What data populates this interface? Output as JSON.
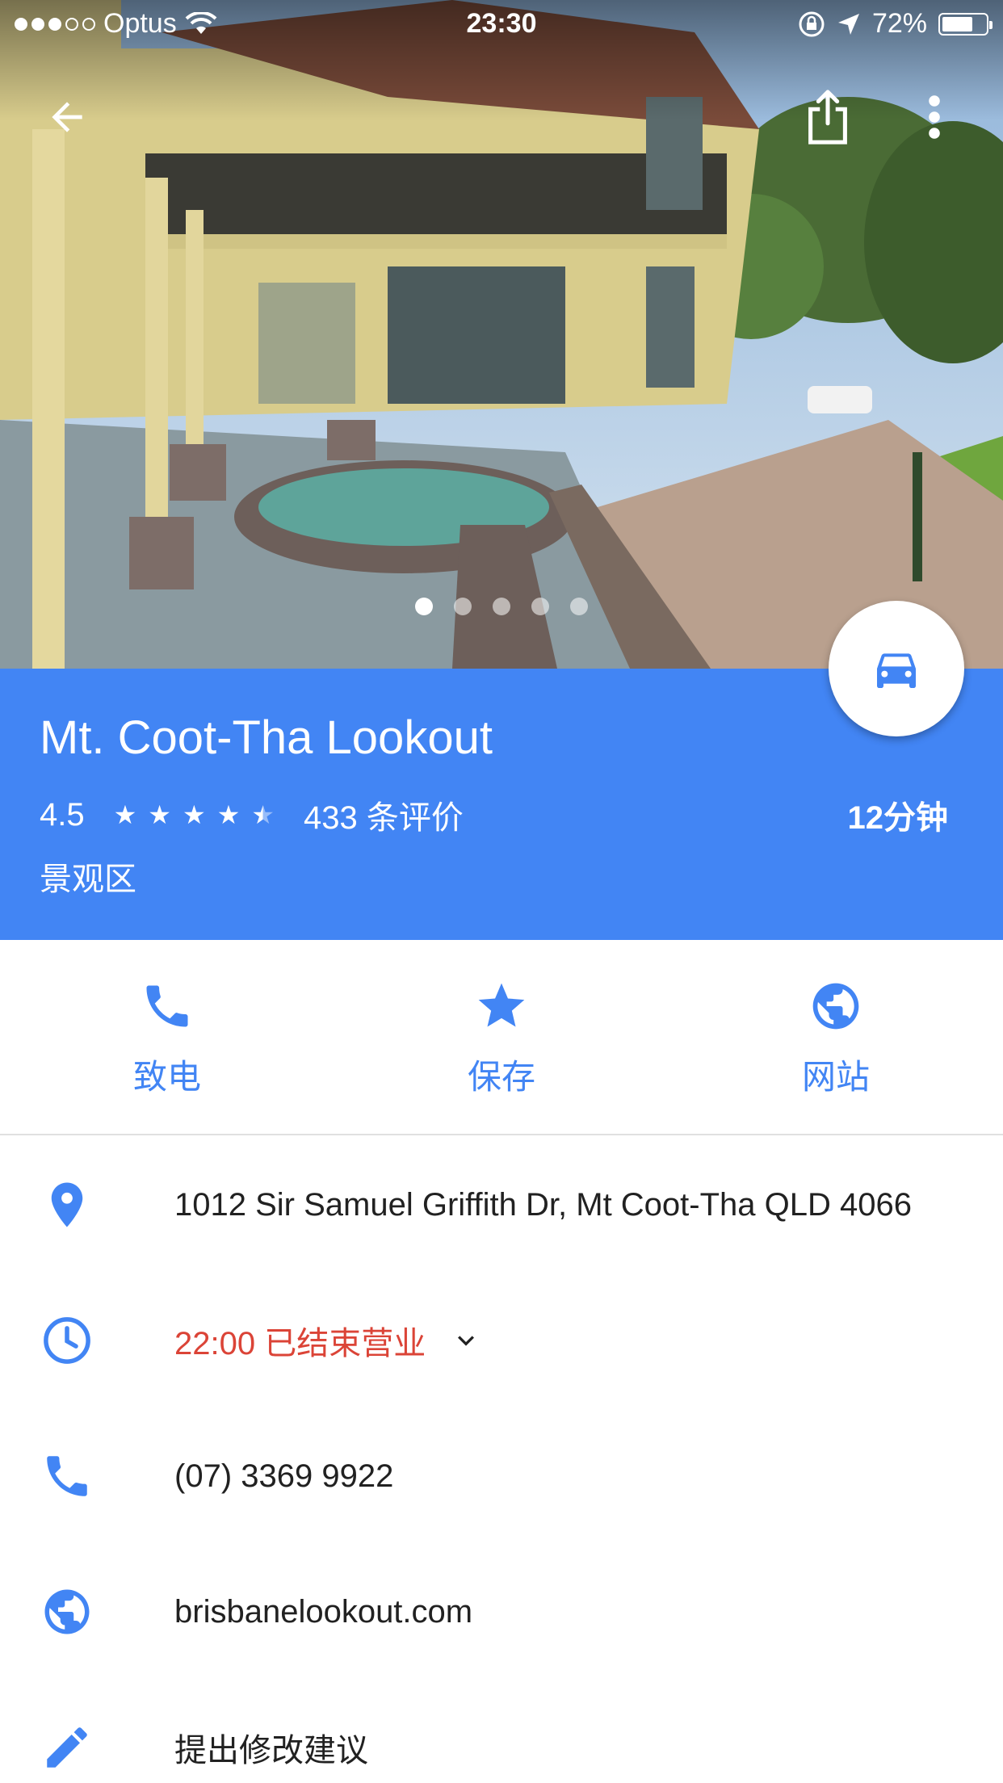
{
  "status_bar": {
    "carrier": "Optus",
    "time": "23:30",
    "battery": "72%",
    "battery_level": 0.72,
    "signal_bars_filled": 3,
    "signal_bars_total": 5
  },
  "hero": {
    "photo_count": 5,
    "active_photo": 1
  },
  "place": {
    "name": "Mt. Coot-Tha Lookout",
    "rating": "4.5",
    "stars_value": 4.5,
    "reviews": "433 条评价",
    "category": "景观区",
    "drive_time": "12分钟"
  },
  "actions": [
    {
      "label": "致电",
      "icon": "phone-icon"
    },
    {
      "label": "保存",
      "icon": "star-icon"
    },
    {
      "label": "网站",
      "icon": "globe-icon"
    }
  ],
  "details": {
    "address": "1012 Sir Samuel Griffith Dr, Mt Coot-Tha QLD 4066",
    "hours": "22:00 已结束营业",
    "phone": "(07) 3369 9922",
    "website": "brisbanelookout.com",
    "suggest_edit": "提出修改建议"
  },
  "colors": {
    "accent": "#4285f4",
    "closed": "#db4437",
    "text": "#212121"
  }
}
